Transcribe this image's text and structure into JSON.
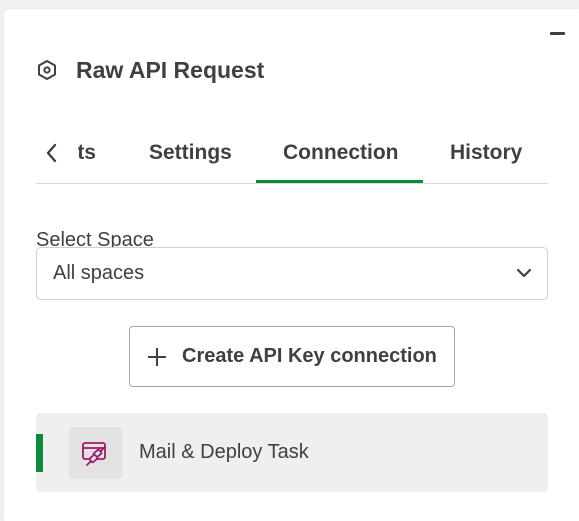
{
  "panel": {
    "title": "Raw API Request",
    "title_icon": "hexagon-node-icon",
    "minimize_icon": "minimize-icon"
  },
  "tabs": {
    "clipped_label": "ts",
    "items": [
      {
        "label": "Settings",
        "active": false
      },
      {
        "label": "Connection",
        "active": true
      },
      {
        "label": "History",
        "active": false
      }
    ],
    "accent_color": "#0a8a3a"
  },
  "space": {
    "label": "Select Space",
    "value": "All spaces"
  },
  "create_button": {
    "label": "Create API Key connection"
  },
  "connections": [
    {
      "label": "Mail & Deploy Task",
      "selected": true,
      "icon": "plug-connection-icon",
      "icon_color": "#9b1b6e"
    }
  ]
}
